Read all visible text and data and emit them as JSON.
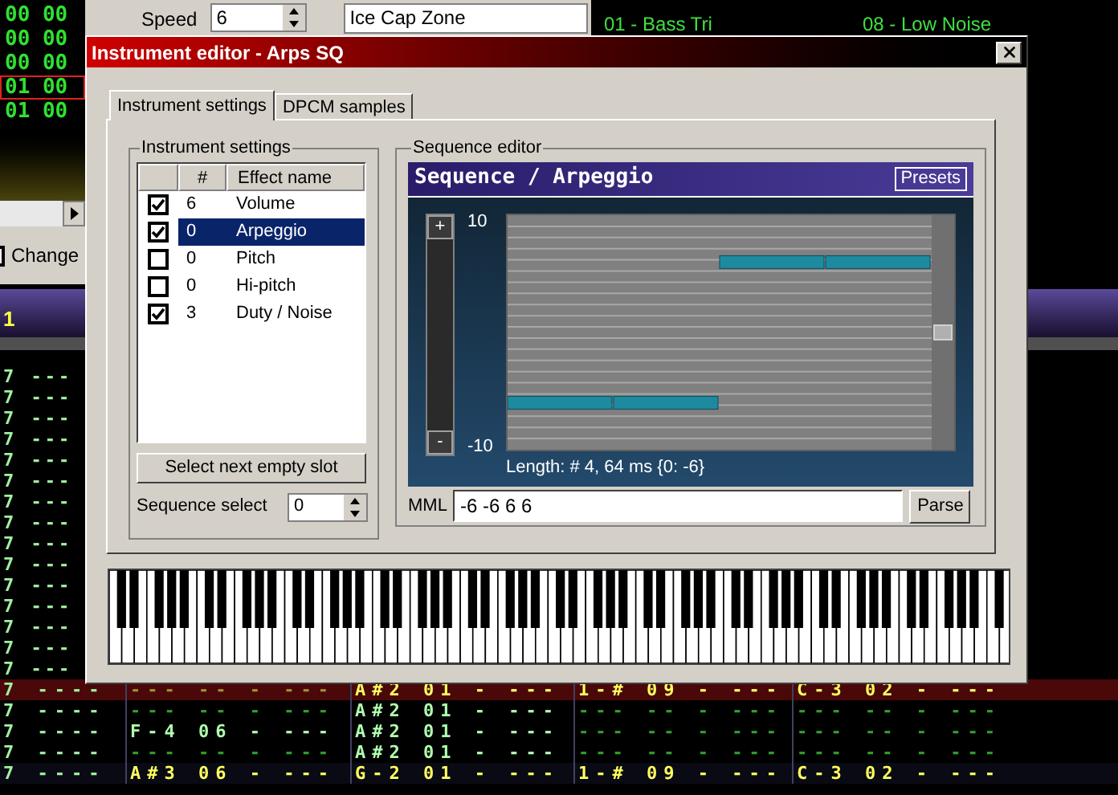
{
  "background": {
    "order_rows": [
      {
        "text": "00 00",
        "selected": false
      },
      {
        "text": "00 00",
        "selected": false
      },
      {
        "text": "00 00",
        "selected": false
      },
      {
        "text": "01 00",
        "selected": true
      },
      {
        "text": "01 00",
        "selected": false
      }
    ],
    "speed": {
      "label": "Speed",
      "value": "6"
    },
    "title_field": {
      "value": "Ice Cap Zone"
    },
    "instruments": [
      {
        "text": "01 - Bass Tri",
        "selected": false
      },
      {
        "text": "08 - Low Noise",
        "selected": false
      }
    ],
    "change_all": {
      "label": "Change"
    },
    "channel_header": {
      "text": "1"
    },
    "pattern_rows": [
      {
        "highlight": false,
        "cursor": false,
        "cells": [
          "7 ---"
        ]
      },
      {
        "highlight": false,
        "cursor": false,
        "cells": [
          "7 ---"
        ]
      },
      {
        "highlight": false,
        "cursor": false,
        "cells": [
          "7 ---"
        ]
      },
      {
        "highlight": false,
        "cursor": false,
        "cells": [
          "7 ---"
        ]
      },
      {
        "highlight": false,
        "cursor": false,
        "cells": [
          "7 ---"
        ]
      },
      {
        "highlight": false,
        "cursor": false,
        "cells": [
          "7 ---"
        ]
      },
      {
        "highlight": false,
        "cursor": false,
        "cells": [
          "7 ---"
        ]
      },
      {
        "highlight": false,
        "cursor": false,
        "cells": [
          "7 ---"
        ]
      },
      {
        "highlight": false,
        "cursor": false,
        "cells": [
          "7 ---"
        ]
      },
      {
        "highlight": false,
        "cursor": false,
        "cells": [
          "7 ---"
        ]
      },
      {
        "highlight": false,
        "cursor": false,
        "cells": [
          "7 ---"
        ]
      },
      {
        "highlight": false,
        "cursor": false,
        "cells": [
          "7 ---"
        ]
      },
      {
        "highlight": false,
        "cursor": false,
        "cells": [
          "7 ---"
        ]
      },
      {
        "highlight": false,
        "cursor": false,
        "cells": [
          "7 ---"
        ]
      },
      {
        "highlight": false,
        "cursor": false,
        "cells": [
          "7 ---"
        ]
      },
      {
        "highlight": true,
        "cursor": true,
        "cells": [
          "7 ----",
          "--- -- - ---",
          "A#2 01 - ---",
          "1-# 09 - ---",
          "C-3 02 - ---"
        ]
      },
      {
        "highlight": false,
        "cursor": false,
        "cells": [
          "7 ----",
          "--- -- - ---",
          "A#2 01 - ---",
          "--- -- - ---",
          "--- -- - ---"
        ]
      },
      {
        "highlight": false,
        "cursor": false,
        "cells": [
          "7 ----",
          "F-4 06 - ---",
          "A#2 01 - ---",
          "--- -- - ---",
          "--- -- - ---"
        ]
      },
      {
        "highlight": false,
        "cursor": false,
        "cells": [
          "7 ----",
          "--- -- - ---",
          "A#2 01 - ---",
          "--- -- - ---",
          "--- -- - ---"
        ]
      },
      {
        "highlight": true,
        "cursor": false,
        "cells": [
          "7 ----",
          "A#3 06 - ---",
          "G-2 01 - ---",
          "1-# 09 - ---",
          "C-3 02 - ---"
        ]
      }
    ]
  },
  "dialog": {
    "title": "Instrument editor - Arps SQ",
    "tabs": [
      {
        "label": "Instrument settings",
        "selected": true
      },
      {
        "label": "DPCM samples",
        "selected": false
      }
    ],
    "settings_group": {
      "title": "Instrument settings",
      "columns": [
        "#",
        "Effect name"
      ],
      "rows": [
        {
          "checked": true,
          "number": "6",
          "name": "Volume",
          "selected": false
        },
        {
          "checked": true,
          "number": "0",
          "name": "Arpeggio",
          "selected": true
        },
        {
          "checked": false,
          "number": "0",
          "name": "Pitch",
          "selected": false
        },
        {
          "checked": false,
          "number": "0",
          "name": "Hi-pitch",
          "selected": false
        },
        {
          "checked": true,
          "number": "3",
          "name": "Duty / Noise",
          "selected": false
        }
      ],
      "button": "Select next empty slot",
      "sequence_select": {
        "label": "Sequence select",
        "value": "0"
      }
    },
    "sequence_group": {
      "title": "Sequence editor",
      "header": "Sequence / Arpeggio",
      "presets": "Presets",
      "plus": "+",
      "minus": "-",
      "y_max": "10",
      "y_min": "-10",
      "length": "Length: # 4, 64 ms {0: -6}",
      "mml_label": "MML",
      "mml_value": "-6 -6 6 6",
      "parse": "Parse"
    }
  }
}
